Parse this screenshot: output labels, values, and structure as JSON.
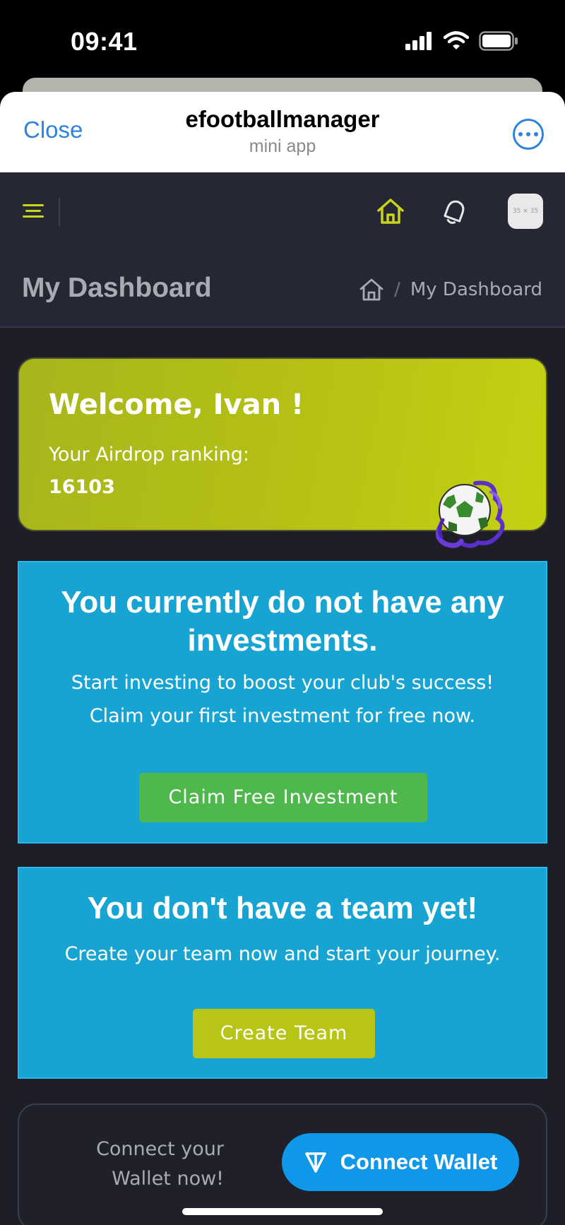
{
  "status_bar": {
    "time": "09:41"
  },
  "telegram_header": {
    "close_label": "Close",
    "title": "efootballmanager",
    "subtitle": "mini app"
  },
  "nav": {
    "avatar_text": "35 × 35",
    "accent_color": "#c7d417"
  },
  "page": {
    "title": "My Dashboard",
    "breadcrumb_current": "My Dashboard",
    "breadcrumb_separator": "/"
  },
  "welcome": {
    "title": "Welcome, Ivan !",
    "ranking_label": "Your Airdrop ranking:",
    "ranking_value": "16103"
  },
  "investments": {
    "title": "You currently do not have any investments.",
    "text_line1": "Start investing to boost your club's success!",
    "text_line2": "Claim your first investment for free now.",
    "button_label": "Claim Free Investment"
  },
  "team": {
    "title": "You don't have a team yet!",
    "text": "Create your team now and start your journey.",
    "button_label": "Create Team"
  },
  "wallet": {
    "text_line1": "Connect your",
    "text_line2": "Wallet now!",
    "button_label": "Connect Wallet"
  }
}
